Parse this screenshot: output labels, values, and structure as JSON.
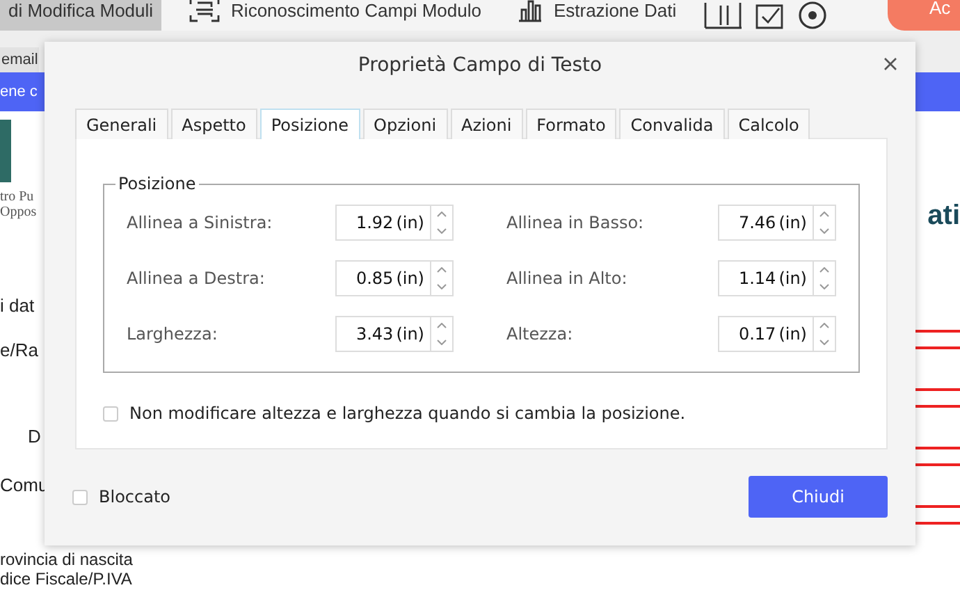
{
  "toolbar": {
    "items": [
      {
        "label": "di Modifica Moduli",
        "selected": true
      },
      {
        "label": "Riconoscimento Campi Modulo",
        "selected": false
      },
      {
        "label": "Estrazione Dati",
        "selected": false
      }
    ],
    "action_button": "Ac"
  },
  "document_tab": "email",
  "banner": "ene c",
  "document": {
    "logo_lines": [
      "tro Pu",
      "Oppos"
    ],
    "heading": "ati",
    "labels": [
      "i dat",
      "e/Ra",
      "D",
      "Comu",
      "rovincia di nascita",
      "dice Fiscale/P.IVA"
    ]
  },
  "dialog": {
    "title": "Proprietà Campo di Testo",
    "tabs": [
      {
        "label": "Generali",
        "selected": false
      },
      {
        "label": "Aspetto",
        "selected": false
      },
      {
        "label": "Posizione",
        "selected": true
      },
      {
        "label": "Opzioni",
        "selected": false
      },
      {
        "label": "Azioni",
        "selected": false
      },
      {
        "label": "Formato",
        "selected": false
      },
      {
        "label": "Convalida",
        "selected": false
      },
      {
        "label": "Calcolo",
        "selected": false
      }
    ],
    "group": "Posizione",
    "fields": [
      {
        "label": "Allinea a Sinistra:",
        "value": "1.92",
        "unit": "(in)"
      },
      {
        "label": "Allinea in Basso:",
        "value": "7.46",
        "unit": "(in)"
      },
      {
        "label": "Allinea a Destra:",
        "value": "0.85",
        "unit": "(in)"
      },
      {
        "label": "Allinea in Alto:",
        "value": "1.14",
        "unit": "(in)"
      },
      {
        "label": "Larghezza:",
        "value": "3.43",
        "unit": "(in)"
      },
      {
        "label": "Altezza:",
        "value": "0.17",
        "unit": "(in)"
      }
    ],
    "keep_size": {
      "label": "Non modificare altezza e larghezza quando si cambia la posizione.",
      "checked": false
    },
    "locked": {
      "label": "Bloccato",
      "checked": false
    },
    "close_button": "Chiudi"
  }
}
